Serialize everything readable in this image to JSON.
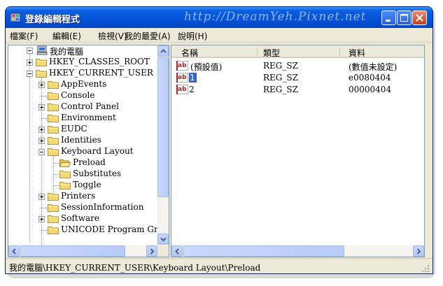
{
  "window": {
    "title": "登錄編輯程式",
    "watermark": "http://DreamYeh.Pixnet.net"
  },
  "menu": [
    {
      "label": "檔案(F)"
    },
    {
      "label": "編輯(E)"
    },
    {
      "label": "檢視(V)"
    },
    {
      "label": "我的最愛(A)"
    },
    {
      "label": "說明(H)"
    }
  ],
  "tree": {
    "root": "我的電腦",
    "nodes": [
      {
        "label": "HKEY_CLASSES_ROOT",
        "expander": "plus"
      },
      {
        "label": "HKEY_CURRENT_USER",
        "expander": "minus"
      },
      {
        "label": "AppEvents",
        "expander": "plus"
      },
      {
        "label": "Console",
        "expander": "none"
      },
      {
        "label": "Control Panel",
        "expander": "plus"
      },
      {
        "label": "Environment",
        "expander": "none"
      },
      {
        "label": "EUDC",
        "expander": "plus"
      },
      {
        "label": "Identities",
        "expander": "plus"
      },
      {
        "label": "Keyboard Layout",
        "expander": "minus"
      },
      {
        "label": "Preload",
        "expander": "none",
        "selected": true
      },
      {
        "label": "Substitutes",
        "expander": "none"
      },
      {
        "label": "Toggle",
        "expander": "none"
      },
      {
        "label": "Printers",
        "expander": "plus"
      },
      {
        "label": "SessionInformation",
        "expander": "none"
      },
      {
        "label": "Software",
        "expander": "plus"
      },
      {
        "label": "UNICODE Program Gro",
        "expander": "none"
      }
    ]
  },
  "list": {
    "columns": [
      "名稱",
      "類型",
      "資料"
    ],
    "rows": [
      {
        "name": "(預設值)",
        "type": "REG_SZ",
        "data": "(數值未設定)",
        "editing": false
      },
      {
        "name": "1",
        "type": "REG_SZ",
        "data": "e0080404",
        "editing": true
      },
      {
        "name": "2",
        "type": "REG_SZ",
        "data": "00000404",
        "editing": false
      }
    ]
  },
  "status": {
    "path": "我的電腦\\HKEY_CURRENT_USER\\Keyboard Layout\\Preload"
  },
  "icons": {
    "app": "registry-editor-icon",
    "folder": "folder-icon",
    "computer": "computer-icon",
    "string_value": "string-value-icon"
  }
}
